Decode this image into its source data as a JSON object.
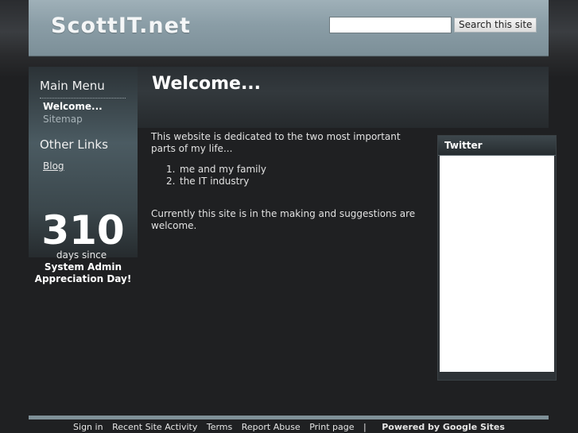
{
  "header": {
    "site_title": "ScottIT.net",
    "search_value": "",
    "search_button": "Search this site"
  },
  "sidebar": {
    "main_menu_heading": "Main Menu",
    "main_menu_items": [
      "Welcome...",
      "Sitemap"
    ],
    "other_links_heading": "Other Links",
    "other_links_items": [
      "Blog"
    ],
    "counter": {
      "number": "310",
      "unit_text": "days since",
      "event_text": "System Admin Appreciation Day!"
    }
  },
  "main": {
    "page_title": "Welcome...",
    "intro": "This website is dedicated to the two most important parts of my life...",
    "list": [
      {
        "num": "1.",
        "text": "me and my family"
      },
      {
        "num": "2.",
        "text": "the IT industry"
      }
    ],
    "outro": "Currently this site is in the making and suggestions are welcome."
  },
  "twitter": {
    "title": "Twitter"
  },
  "footer": {
    "links": [
      "Sign in",
      "Recent Site Activity",
      "Terms",
      "Report Abuse",
      "Print page",
      "|"
    ],
    "powered_by": "Powered by Google Sites"
  }
}
